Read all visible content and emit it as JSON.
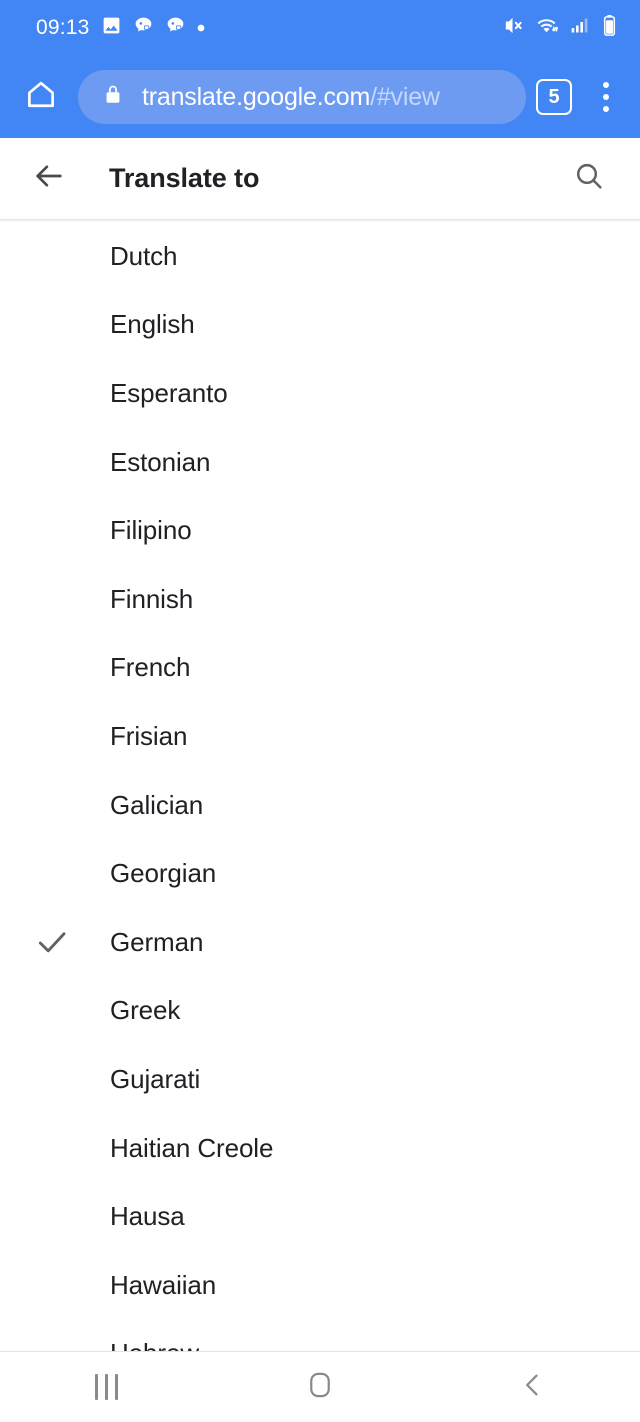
{
  "statusbar": {
    "clock": "09:13",
    "left_icons": [
      "image-icon",
      "chat-bubble-icon",
      "chat-bubble-icon",
      "dot-icon"
    ],
    "right_icons": [
      "mute-icon",
      "wifi-icon",
      "cellular-signal-icon",
      "battery-icon"
    ]
  },
  "browser": {
    "home_icon": "home-icon",
    "lock_icon": "lock-icon",
    "url_main": "translate.google.com",
    "url_fragment": "/#view",
    "tab_count": "5",
    "menu_icon": "kebab-menu-icon",
    "chrome_color": "#4285f4",
    "urlbar_color": "#6e9bf2"
  },
  "appbar": {
    "back_icon": "back-arrow-icon",
    "title": "Translate to",
    "search_icon": "search-icon"
  },
  "language_list": {
    "selected": "German",
    "check_icon": "check-icon",
    "items": [
      {
        "label": "Dutch",
        "selected": false
      },
      {
        "label": "English",
        "selected": false
      },
      {
        "label": "Esperanto",
        "selected": false
      },
      {
        "label": "Estonian",
        "selected": false
      },
      {
        "label": "Filipino",
        "selected": false
      },
      {
        "label": "Finnish",
        "selected": false
      },
      {
        "label": "French",
        "selected": false
      },
      {
        "label": "Frisian",
        "selected": false
      },
      {
        "label": "Galician",
        "selected": false
      },
      {
        "label": "Georgian",
        "selected": false
      },
      {
        "label": "German",
        "selected": true
      },
      {
        "label": "Greek",
        "selected": false
      },
      {
        "label": "Gujarati",
        "selected": false
      },
      {
        "label": "Haitian Creole",
        "selected": false
      },
      {
        "label": "Hausa",
        "selected": false
      },
      {
        "label": "Hawaiian",
        "selected": false
      },
      {
        "label": "Hebrew",
        "selected": false
      }
    ]
  },
  "navbar": {
    "recents_label": "recents-icon",
    "home_label": "home-icon",
    "back_label": "back-icon"
  }
}
